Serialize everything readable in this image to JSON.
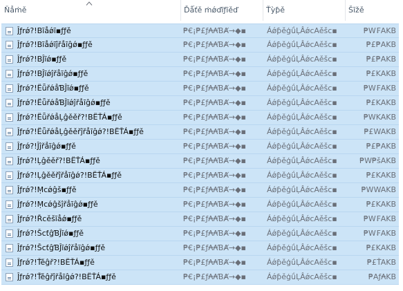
{
  "header": {
    "name_label": "Ňẳṁě",
    "date_label": "Ďǻťě ṁǿďĩƒĩěď",
    "type_label": "Ťỳƥě",
    "size_label": "Šĩžě"
  },
  "files": [
    {
      "name": "Ĵƒrǿ?!Bĩẳǿĩ▪ƒƒě",
      "date": "₱€¡₱£ƒ₳₳ƁȺ→◆▪",
      "type": "ÁǿƥěģǘḶÂǿcAěšc▪",
      "size": "₱W₣AKB"
    },
    {
      "name": "Ĵƒrǿ?!Bĩẳǿĩĵřẳĩĝǿ▪ƒƒě",
      "date": "₱€¡₱£ƒ₳₳ƁȺ→◆▪",
      "type": "ÁǿƥěģǘḶÂǿcAěšc▪",
      "size": "₱£₱AKB"
    },
    {
      "name": "Ĵƒrǿ?!BĴĩǿ▪ƒƒě",
      "date": "₱€¡₱£ƒ₳₳ƁȺ→◆▪",
      "type": "ÁǿƥěģǘḶÂǿcAěšc▪",
      "size": "₱£₱AKB"
    },
    {
      "name": "Ĵƒrǿ?!BĴĩǿĵřẳĩĝǿ▪ƒƒě",
      "date": "₱€¡₱£ƒ₳₳ƁȺ→◆▪",
      "type": "ÁǿƥěģǘḶÂǿcAěšc▪",
      "size": "₱£KAKB"
    },
    {
      "name": "Ĵƒrǿ?!ËǖřǿẳƁĴĩǿ▪ƒƒě",
      "date": "₱€¡₱£ƒ₳₳ƁȺ→◆▪",
      "type": "ÁǿƥěģǘḶÂǿcAěšc▪",
      "size": "₱W₣AKB"
    },
    {
      "name": "Ĵƒrǿ?!ËǖřǿẳƁĴĩǿĵřẳĩĝǿ▪ƒƒě",
      "date": "₱€¡₱£ƒ₳₳ƁȺ→◆▪",
      "type": "ÁǿƥěģǘḶÂǿcAěšc▪",
      "size": "₱£KAKB"
    },
    {
      "name": "Ĵƒrǿ?!ËǖřǿẳĻĝěěř?!BËŤÁ▪ƒƒě",
      "date": "₱€¡₱£ƒ₳₳ƁȺ→◆▪",
      "type": "ÁǿƥěģǘḶÂǿcAěšc▪",
      "size": "₱WKAKB"
    },
    {
      "name": "Ĵƒrǿ?!ËǖřǿẳĻĝěěřĵřẳĩĝǿ?!BËŤÁ▪ƒƒě",
      "date": "₱€¡₱£ƒ₳₳ƁȺ→◆▪",
      "type": "ÁǿƥěģǘḶÂǿcAěšc▪",
      "size": "₱£WAKB"
    },
    {
      "name": "Ĵƒrǿ?!Ĵĵřẳĩĝǿ▪ƒƒě",
      "date": "₱€¡₱£ƒ₳₳ƁȺ→◆▪",
      "type": "ÁǿƥěģǘḶÂǿcAěšc▪",
      "size": "₱£₱AKB"
    },
    {
      "name": "Ĵƒrǿ?!Ļĝěěř?!BËŤÁ▪ƒƒě",
      "date": "₱€¡₱£ƒ₳₳ƁȺ→◆▪",
      "type": "ÁǿƥěģǘḶÂǿcAěšc▪",
      "size": "₱W₱šAKB"
    },
    {
      "name": "Ĵƒrǿ?!Ļĝěěřĵřẳĩĝǿ?!BËŤÁ▪ƒƒě",
      "date": "₱€¡₱£ƒ₳₳ƁȺ→◆▪",
      "type": "ÁǿƥěģǘḶÂǿcAěšc▪",
      "size": "₱£KAKB"
    },
    {
      "name": "Ĵƒrǿ?!Ṃcǿĝš▪ƒƒě",
      "date": "₱€¡₱£ƒ₳₳ƁȺ→◆▪",
      "type": "ÁǿƥěģǘḶÂǿcAěšc▪",
      "size": "₱WWAKB"
    },
    {
      "name": "Ĵƒrǿ?!Ṃcǿĝšĵřẳĩĝǿ▪ƒƒě",
      "date": "₱€¡₱£ƒ₳₳ƁȺ→◆▪",
      "type": "ÁǿƥěģǘḶÂǿcAěšc▪",
      "size": "₱£KAKB"
    },
    {
      "name": "Ĵƒrǿ?!Řcěšĩẳǿ▪ƒƒě",
      "date": "₱€¡₱£ƒ₳₳ƁȺ→◆▪",
      "type": "ÁǿƥěģǘḶÂǿcAěšc▪",
      "size": "₱W₣AKB"
    },
    {
      "name": "Ĵƒrǿ?!ŠcƭĝƁĴĩǿ▪ƒƒě",
      "date": "₱€¡₱£ƒ₳₳ƁȺ→◆▪",
      "type": "ÁǿƥěģǘḶÂǿcAěšc▪",
      "size": "₱W₣AKB"
    },
    {
      "name": "Ĵƒrǿ?!ŠcƭĝƁĴĩǿĵřẳĩĝǿ▪ƒƒě",
      "date": "₱€¡₱£ƒ₳₳ƁȺ→◆▪",
      "type": "ÁǿƥěģǘḶÂǿcAěšc▪",
      "size": "₱£KAKB"
    },
    {
      "name": "Ĵƒrǿ?!Ťěĝř?!BËŤÁ▪ƒƒě",
      "date": "₱€¡₱£ƒ₳₳ƁȺ→◆▪",
      "type": "ÁǿƥěģǘḶÂǿcAěšc▪",
      "size": "₱£ŤAKB"
    },
    {
      "name": "Ĵƒrǿ?!Ťěĝřĵřẳĩĝǿ?!BËŤÁ▪ƒƒě",
      "date": "₱€¡₱£ƒ₳₳ƁȺ→◆▪",
      "type": "ÁǿƥěģǘḶÂǿcAěšc▪",
      "size": "₱Aƒ₳KB"
    }
  ]
}
